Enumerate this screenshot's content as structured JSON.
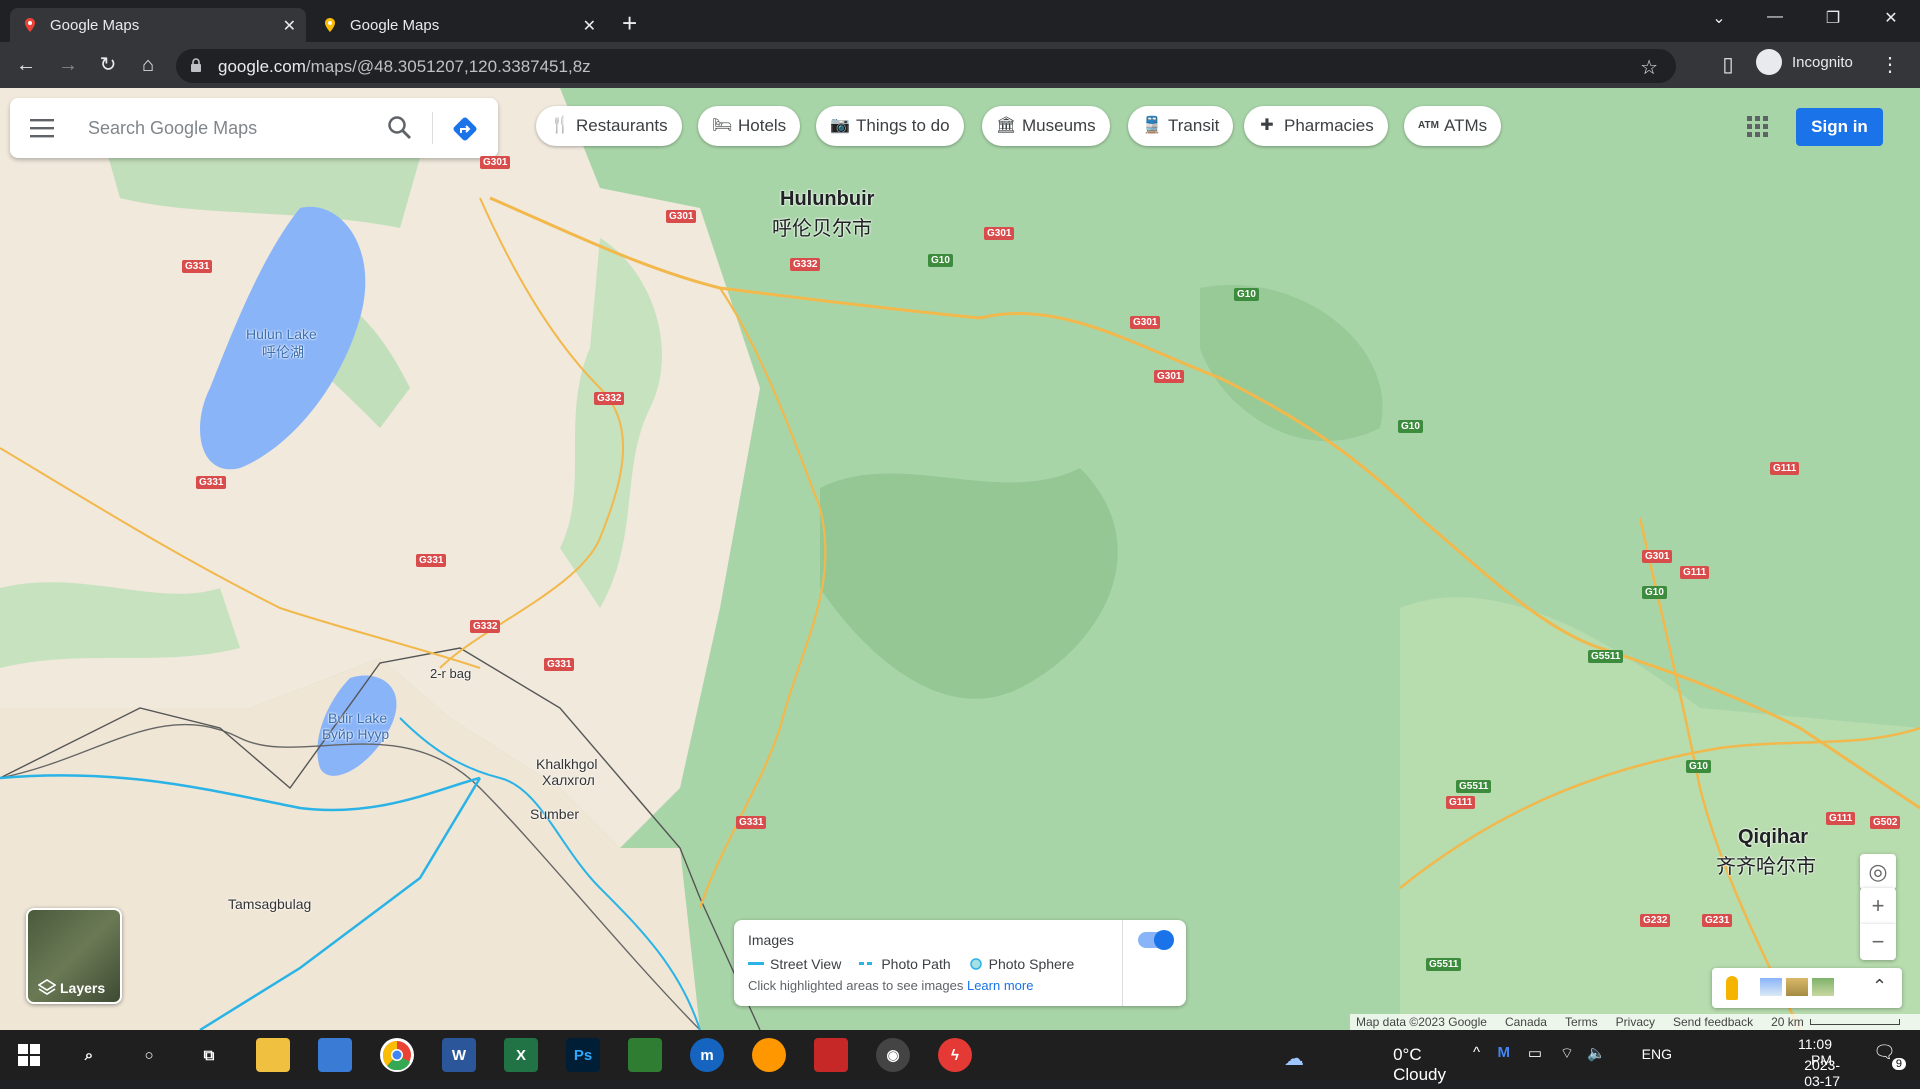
{
  "browser": {
    "tabs": [
      {
        "title": "Google Maps"
      },
      {
        "title": "Google Maps"
      }
    ],
    "url_host": "google.com",
    "url_path": "/maps/@48.3051207,120.3387451,8z",
    "incognito_label": "Incognito"
  },
  "search": {
    "placeholder": "Search Google Maps"
  },
  "chips": [
    {
      "label": "Restaurants",
      "icon": "restaurant-icon"
    },
    {
      "label": "Hotels",
      "icon": "hotel-icon"
    },
    {
      "label": "Things to do",
      "icon": "camera-icon"
    },
    {
      "label": "Museums",
      "icon": "museum-icon"
    },
    {
      "label": "Transit",
      "icon": "transit-icon"
    },
    {
      "label": "Pharmacies",
      "icon": "pharmacy-icon"
    },
    {
      "label": "ATMs",
      "icon": "atm-icon"
    }
  ],
  "signin_label": "Sign in",
  "map_labels": {
    "hulunbuir": "Hulunbuir",
    "hulunbuir_cn": "呼伦贝尔市",
    "hulun_lake": "Hulun Lake",
    "hulun_lake_cn": "呼伦湖",
    "buir_lake": "Buir Lake",
    "buir_lake_mn": "Буйр Нуур",
    "bag": "2-r bag",
    "khalkhgol": "Khalkhgol",
    "khalkhgol_mn": "Халхгол",
    "sumber": "Sumber",
    "tamsagbulag": "Tamsagbulag",
    "qiqihar": "Qiqihar",
    "qiqihar_cn": "齐齐哈尔市"
  },
  "road_shields": [
    "G301",
    "G301",
    "G332",
    "G10",
    "G301",
    "G10",
    "G301",
    "G301",
    "G10",
    "G331",
    "G332",
    "G331",
    "G331",
    "G332",
    "G331",
    "G331",
    "G111",
    "G301",
    "G111",
    "G10",
    "G5511",
    "G10",
    "G5511",
    "G111",
    "G111",
    "G502",
    "G232",
    "G231",
    "G5511"
  ],
  "layers_label": "Layers",
  "images_panel": {
    "title": "Images",
    "street_view": "Street View",
    "photo_path": "Photo Path",
    "photo_sphere": "Photo Sphere",
    "hint": "Click highlighted areas to see images",
    "learn_more": "Learn more"
  },
  "attribution": {
    "map_data": "Map data ©2023 Google",
    "country": "Canada",
    "terms": "Terms",
    "privacy": "Privacy",
    "feedback": "Send feedback",
    "scale": "20 km"
  },
  "taskbar": {
    "weather": "0°C  Cloudy",
    "lang": "ENG",
    "time": "11:09 PM",
    "date": "2023-03-17",
    "notifications": "9"
  },
  "colors": {
    "accent": "#1a73e8",
    "map_green": "#a8d5a8",
    "map_tan": "#f0e9dc",
    "water": "#8ab4f8"
  }
}
